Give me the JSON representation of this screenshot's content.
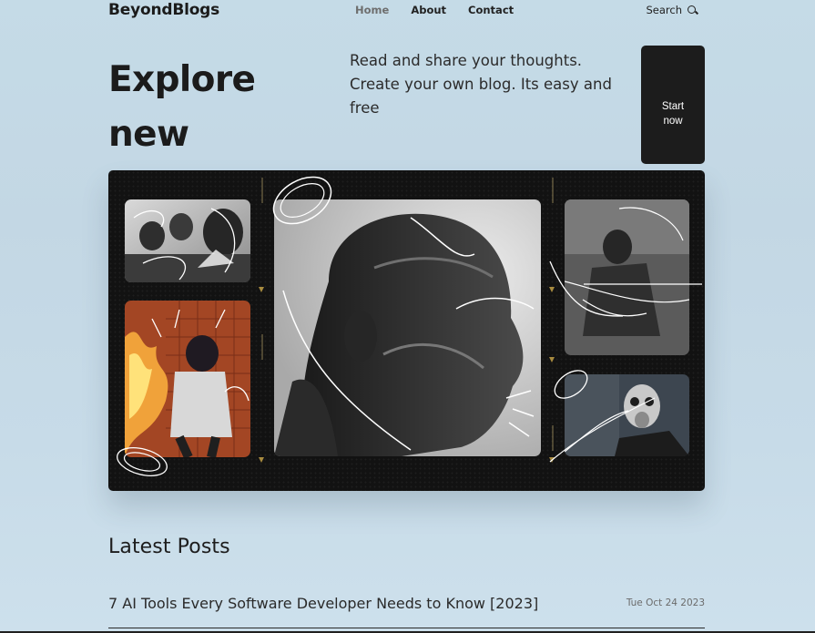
{
  "brand": "BeyondBlogs",
  "nav": {
    "links": [
      "Home",
      "About",
      "Contact"
    ],
    "active": "Home",
    "search_label": "Search"
  },
  "hero": {
    "title": "Explore new possiblities",
    "subtitle": "Read and share your thoughts. Create your own blog. Its easy and free",
    "cta_label": "Start now"
  },
  "colors": {
    "page_background": "#c5dbe7",
    "cta_background": "#1c1c1c",
    "collage_background": "#121212",
    "film_mark": "#a88b3f"
  },
  "latest_posts": {
    "heading": "Latest Posts",
    "items": [
      {
        "title": "7 AI Tools Every Software Developer Needs to Know [2023]",
        "date": "Tue Oct 24 2023"
      }
    ]
  }
}
